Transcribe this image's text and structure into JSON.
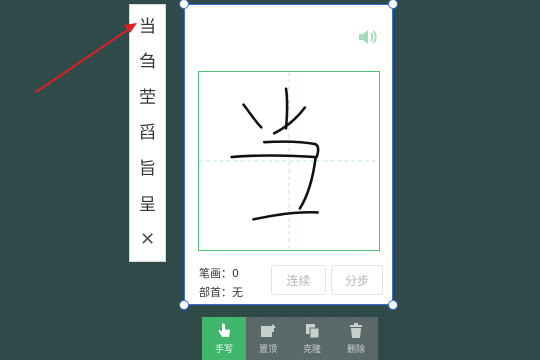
{
  "candidates": [
    "当",
    "刍",
    "茔",
    "舀",
    "旨",
    "呈"
  ],
  "candidates_close_glyph": "✕",
  "panel": {
    "stroke_label": "笔画：0",
    "radical_label": "部首：无",
    "btn_continuous": "连续",
    "btn_split": "分步",
    "speaker_icon": "speaker-icon",
    "accent_color": "#4cc27a",
    "selection_color": "#3b6fd6"
  },
  "toolbar": {
    "items": [
      {
        "label": "手写",
        "icon": "hand-pointer-icon",
        "active": true
      },
      {
        "label": "置顶",
        "icon": "pin-top-icon",
        "active": false
      },
      {
        "label": "克隆",
        "icon": "clone-icon",
        "active": false
      },
      {
        "label": "删除",
        "icon": "trash-icon",
        "active": false
      }
    ]
  }
}
